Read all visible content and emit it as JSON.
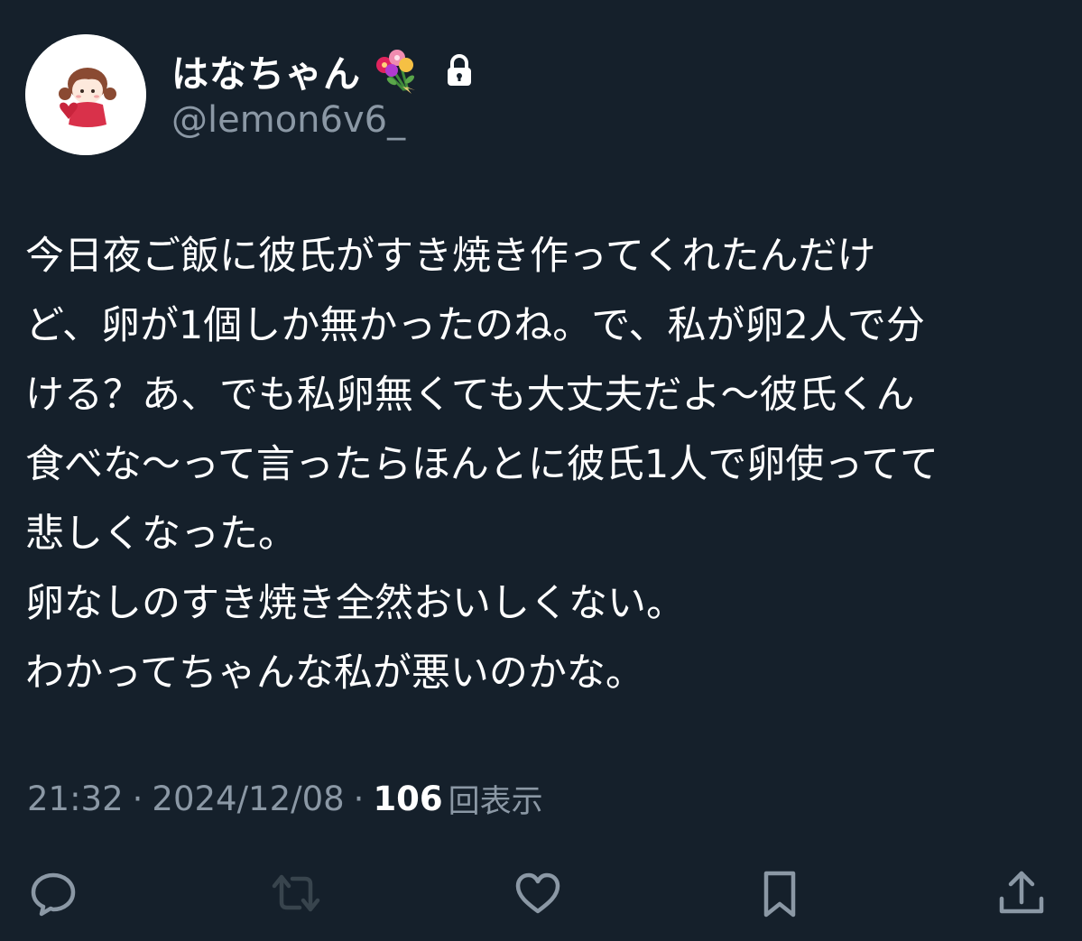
{
  "user": {
    "display_name": "はなちゃん",
    "handle": "@lemon6v6_"
  },
  "tweet": {
    "lines": [
      "今日夜ご飯に彼氏がすき焼き作ってくれたんだけ",
      "ど、卵が1個しか無かったのね。で、私が卵2人で分",
      "ける？あ、でも私卵無くても大丈夫だよ〜彼氏くん",
      "食べな〜って言ったらほんとに彼氏1人で卵使ってて",
      "悲しくなった。",
      "卵なしのすき焼き全然おいしくない。",
      "わかってちゃんな私が悪いのかな。"
    ]
  },
  "meta": {
    "time": "21:32",
    "date": "2024/12/08",
    "separator": "·",
    "views_count": "106",
    "views_label": "回表示"
  },
  "icons": {
    "name_emoji": "bouquet-icon",
    "protected": "lock-icon",
    "actions": [
      "reply-icon",
      "retweet-icon",
      "like-icon",
      "bookmark-icon",
      "share-icon"
    ]
  },
  "colors": {
    "background": "#15202b",
    "text": "#ffffff",
    "secondary": "#8b98a5",
    "retweet_disabled": "#38444d"
  }
}
